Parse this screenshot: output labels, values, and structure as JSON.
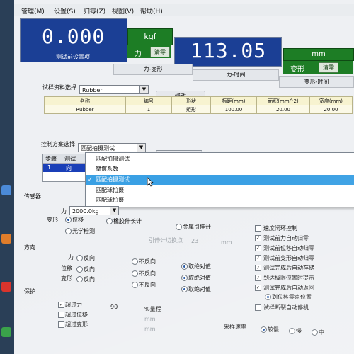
{
  "menu": {
    "items": [
      "管理(M)",
      "设置(S)",
      "归零(Z)",
      "视图(V)",
      "帮助(H)"
    ]
  },
  "displays": {
    "primary_value": "0.000",
    "primary_caption": "测试前设置项",
    "force_unit": "kgf",
    "force_label": "力",
    "reset_label": "清零",
    "force_value": "113.05",
    "disp_unit": "mm",
    "disp_label": "变形",
    "disp_reset_label": "清零"
  },
  "tabs": [
    "力-变形",
    "力-时间",
    "变形-时间"
  ],
  "specimen": {
    "label": "试样资料选择",
    "selected": "Rubber",
    "modify_button": "修改",
    "headers": [
      "名称",
      "编号",
      "形状",
      "标距(mm)",
      "面积(mm^2)",
      "宽度(mm)"
    ],
    "row": [
      "Rubber",
      "1",
      "矩形",
      "100.00",
      "20.00",
      "20.00"
    ]
  },
  "control": {
    "label": "控制方案选择",
    "selected": "匹配拍摄测试",
    "modify_button": "修改",
    "step_headers": [
      "步骤",
      "测试"
    ],
    "step_row": [
      "1",
      "向"
    ],
    "right_text": "匹配"
  },
  "dropdown": {
    "options": [
      "匹配拍摄测试",
      "摩擦系数",
      "匹配拍摄测试",
      "匹配球拍摄",
      "匹配球拍摄"
    ],
    "selected_index": 2,
    "checkmark": "✓"
  },
  "sensor": {
    "label": "传感器",
    "force_label": "力",
    "force_value": "2000.0kg",
    "deform_label": "变形",
    "position": "位移",
    "extensometer": "橡胶伸长计",
    "metal": "金属引伸计",
    "optical": "光学检测",
    "gauge_text": "引伸计切换点",
    "gauge_value": "23",
    "gauge_unit": "mm"
  },
  "direction": {
    "label": "方向",
    "rows": [
      {
        "name": "力",
        "opt": "反向",
        "none": "不反向",
        "auto": "取绝对值"
      },
      {
        "name": "位移",
        "opt": "反向",
        "none": "不反向",
        "auto": "取绝对值"
      },
      {
        "name": "变形",
        "opt": "反向",
        "none": "不反向",
        "auto": "取绝对值"
      }
    ]
  },
  "protect": {
    "label": "保护",
    "items": [
      "超过力",
      "超过位移",
      "超过变形"
    ],
    "force_value": "90",
    "force_unit": "%量程",
    "unit_mm": "mm"
  },
  "right_checks": [
    "速度闭环控制",
    "测试前力自动归零",
    "测试前位移自动归零",
    "测试前变形自动归零",
    "测试完成后自动存储",
    "到达极限位置时提示",
    "测试完成后自动返回",
    "到位移零点位置",
    "试样断裂自动停机"
  ],
  "sampling": {
    "label": "采样速率",
    "options": [
      "较慢",
      "慢",
      "中"
    ],
    "selected": "较慢"
  }
}
